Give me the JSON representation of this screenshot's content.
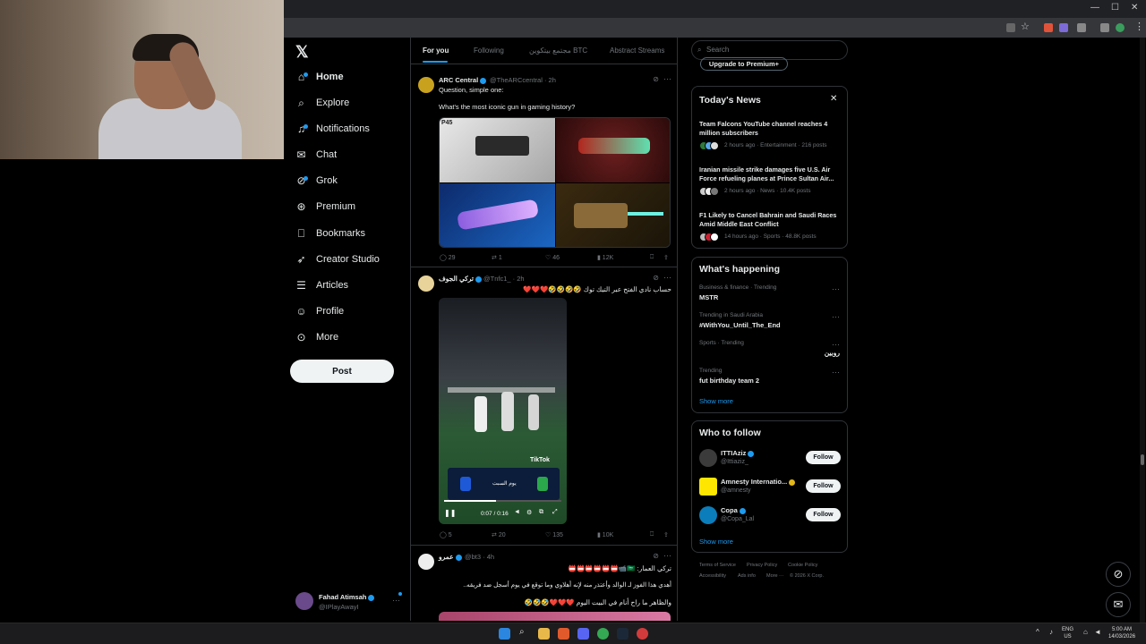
{
  "nav": {
    "items": [
      {
        "label": "Home",
        "icon": "home-icon"
      },
      {
        "label": "Explore",
        "icon": "search-icon"
      },
      {
        "label": "Notifications",
        "icon": "bell-icon"
      },
      {
        "label": "Chat",
        "icon": "chat-icon"
      },
      {
        "label": "Grok",
        "icon": "grok-icon"
      },
      {
        "label": "Premium",
        "icon": "premium-icon"
      },
      {
        "label": "Bookmarks",
        "icon": "bookmark-icon"
      },
      {
        "label": "Creator Studio",
        "icon": "rocket-icon"
      },
      {
        "label": "Articles",
        "icon": "article-icon"
      },
      {
        "label": "Profile",
        "icon": "person-icon"
      },
      {
        "label": "More",
        "icon": "more-circle-icon"
      }
    ],
    "post_label": "Post",
    "profile": {
      "name": "Fahad Atimsah",
      "handle": "@IPlayAwayI"
    }
  },
  "tabs": [
    "For you",
    "Following",
    "مجتمع بيتكوين BTC",
    "Abstract Streams"
  ],
  "tweets": [
    {
      "name": "ARC Central",
      "handle": "@TheARCcentral · 2h",
      "line1": "Question, simple one:",
      "line2": "What's the most iconic gun in gaming history?",
      "image_label": "P45",
      "replies": "29",
      "reposts": "1",
      "likes": "46",
      "views": "12K"
    },
    {
      "name": "تركي الجوف",
      "handle": "@Tnfc1_ · 2h",
      "line1": "حساب نادي الفتح عبر التيك توك 🤣🤣🤣🤣❤️❤️❤️",
      "video_time": "0:07 / 0:16",
      "video_watermark": "TikTok",
      "video_score_label": "يوم السبت",
      "replies": "5",
      "reposts": "20",
      "likes": "135",
      "views": "10K"
    },
    {
      "name": "عمرو",
      "handle": "@bt3 · 4h",
      "line1": "تركي العمار: 🇸🇦📹📛📛📛📛📛📛",
      "line2": "أهدي هذا الفوز لـ الوالد وأعتذر منه لإنه أهلاوي وما توقع في يوم أسجل ضد فريقه..",
      "line3": "والظاهر ما راح أنام في البيت اليوم ❤️❤️❤️🤣🤣🤣"
    }
  ],
  "sidebar": {
    "search_placeholder": "Search",
    "premium_label": "Upgrade to Premium+",
    "news_title": "Today's News",
    "news": [
      {
        "title": "Team Falcons YouTube channel reaches 4 million subscribers",
        "meta": "2 hours ago · Entertainment · 216 posts"
      },
      {
        "title": "Iranian missile strike damages five U.S. Air Force refueling planes at Prince Sultan Air...",
        "meta": "2 hours ago · News · 10.4K posts"
      },
      {
        "title": "F1 Likely to Cancel Bahrain and Saudi Races Amid Middle East Conflict",
        "meta": "14 hours ago · Sports · 48.8K posts"
      }
    ],
    "happening_title": "What's happening",
    "trends": [
      {
        "category": "Business & finance · Trending",
        "name": "MSTR"
      },
      {
        "category": "Trending in Saudi Arabia",
        "name": "#WithYou_Until_The_End"
      },
      {
        "category": "Sports · Trending",
        "name": "روبين"
      },
      {
        "category": "Trending",
        "name": "fut birthday team 2"
      }
    ],
    "show_more": "Show more",
    "wtf_title": "Who to follow",
    "wtf": [
      {
        "name": "ITTIAziz",
        "handle": "@Ittiaziz_",
        "color": "#3b3b3b"
      },
      {
        "name": "Amnesty Internatio...",
        "handle": "@amnesty",
        "color": "#ffe600"
      },
      {
        "name": "Copa",
        "handle": "@Copa_Lal",
        "color": "#0b7dba"
      }
    ],
    "follow_label": "Follow",
    "footer": [
      "Terms of Service",
      "Privacy Policy",
      "Cookie Policy",
      "Accessibility",
      "Ads info",
      "More ···",
      "© 2026 X Corp."
    ]
  },
  "taskbar": {
    "lang": "ENG",
    "region": "US",
    "time": "5:00 AM",
    "date": "14/03/2026"
  },
  "colors": {
    "accent": "#1d9bf0",
    "background": "#000000",
    "border": "#2f3336",
    "muted": "#71767b"
  }
}
